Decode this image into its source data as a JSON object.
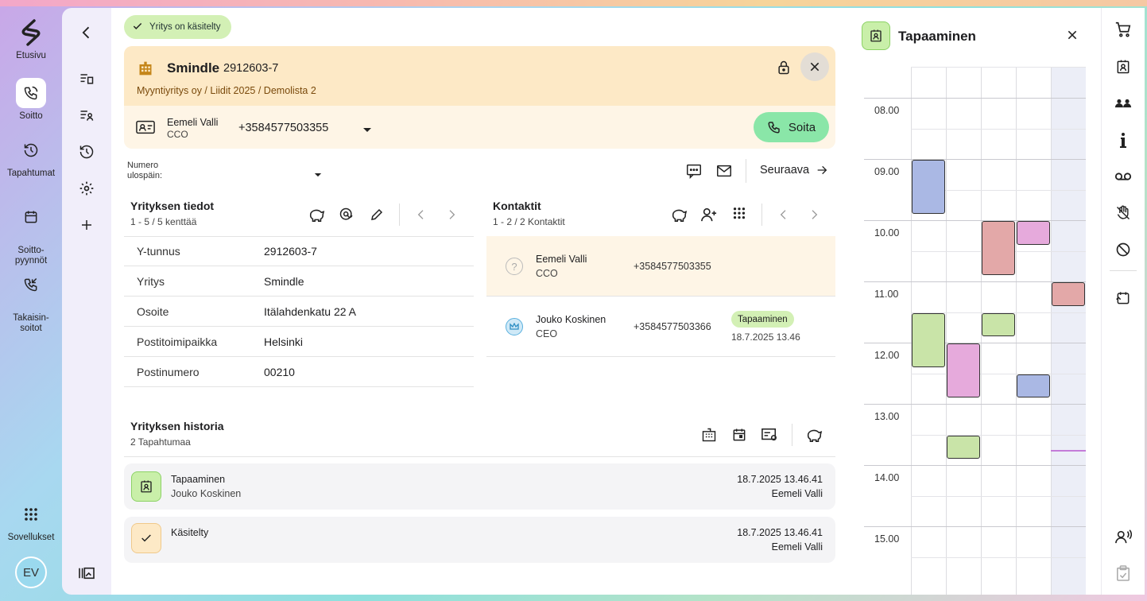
{
  "nav": {
    "items": [
      {
        "label": "Etusivu"
      },
      {
        "label": "Soitto"
      },
      {
        "label": "Tapahtumat"
      },
      {
        "label": "Soitto-\npyynnöt"
      },
      {
        "label": "Takaisin-\nsoitot"
      }
    ],
    "apps_label": "Sovellukset",
    "avatar_initials": "EV"
  },
  "status_badge": "Yritys on käsitelty",
  "company": {
    "name": "Smindle",
    "business_id": "2912603-7",
    "breadcrumb": [
      "Myyntiyritys oy",
      "Liidit 2025",
      "Demolista 2"
    ]
  },
  "contact_bar": {
    "name": "Eemeli Valli",
    "title": "CCO",
    "phone": "+3584577503355",
    "call_label": "Soita"
  },
  "outbound": {
    "label": "Numero ulospäin:",
    "next_label": "Seuraava"
  },
  "company_info": {
    "title": "Yrityksen tiedot",
    "count": "1 - 5 / 5 kenttää",
    "rows": [
      {
        "key": "Y-tunnus",
        "value": "2912603-7"
      },
      {
        "key": "Yritys",
        "value": "Smindle"
      },
      {
        "key": "Osoite",
        "value": "Itälahdenkatu 22 A"
      },
      {
        "key": "Postitoimipaikka",
        "value": "Helsinki"
      },
      {
        "key": "Postinumero",
        "value": "00210"
      }
    ]
  },
  "contacts": {
    "title": "Kontaktit",
    "count": "1 - 2 / 2 Kontaktit",
    "items": [
      {
        "name": "Eemeli Valli",
        "title": "CCO",
        "phone": "+3584577503355",
        "tag": "",
        "date": ""
      },
      {
        "name": "Jouko Koskinen",
        "title": "CEO",
        "phone": "+3584577503366",
        "tag": "Tapaaminen",
        "date": "18.7.2025 13.46"
      }
    ]
  },
  "history": {
    "title": "Yrityksen historia",
    "count": "2 Tapahtumaa",
    "items": [
      {
        "type": "Tapaaminen",
        "person": "Jouko Koskinen",
        "date": "18.7.2025 13.46.41",
        "user": "Eemeli Valli"
      },
      {
        "type": "Käsitelty",
        "person": "",
        "date": "18.7.2025 13.46.41",
        "user": "Eemeli Valli"
      }
    ]
  },
  "calendar": {
    "title": "Tapaaminen",
    "hours": [
      "08.00",
      "09.00",
      "10.00",
      "11.00",
      "12.00",
      "13.00",
      "14.00",
      "15.00"
    ],
    "events": [
      {
        "day": 1,
        "start": 9.0,
        "end": 9.9,
        "color": "#aab8e4"
      },
      {
        "day": 3,
        "start": 10.0,
        "end": 10.9,
        "color": "#e3a8a8"
      },
      {
        "day": 4,
        "start": 10.0,
        "end": 10.4,
        "color": "#e6aadc"
      },
      {
        "day": 5,
        "start": 11.0,
        "end": 11.4,
        "color": "#e3a8a8"
      },
      {
        "day": 1,
        "start": 11.5,
        "end": 12.4,
        "color": "#c9e4a8"
      },
      {
        "day": 3,
        "start": 11.5,
        "end": 11.9,
        "color": "#c9e4a8"
      },
      {
        "day": 2,
        "start": 12.0,
        "end": 12.9,
        "color": "#e6aadc"
      },
      {
        "day": 4,
        "start": 12.5,
        "end": 12.9,
        "color": "#aab8e4"
      },
      {
        "day": 2,
        "start": 13.5,
        "end": 13.9,
        "color": "#c9e4a8"
      }
    ],
    "now_hour": 13.75
  },
  "colors": {
    "accent_green": "#8ae6a8",
    "company_bg": "#fde9c6",
    "badge_green": "#d3f0b5"
  }
}
